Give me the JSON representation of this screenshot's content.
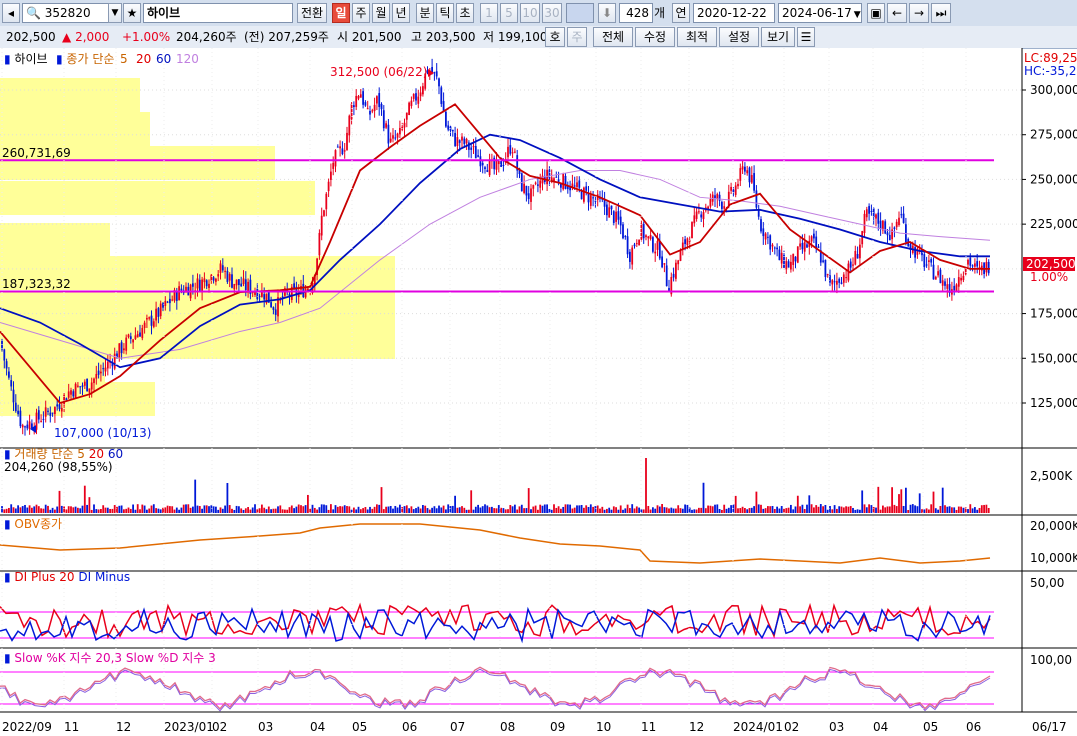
{
  "toolbar": {
    "code": "352820",
    "name": "하이브",
    "convert_label": "전환",
    "periods": [
      "일",
      "주",
      "월",
      "년"
    ],
    "minute_units": [
      "분",
      "틱",
      "초"
    ],
    "intervals": [
      "1",
      "5",
      "10",
      "30"
    ],
    "count": "428",
    "count_unit": "개",
    "date_mode": "연",
    "start_date": "2020-12-22",
    "end_date": "2024-06-17"
  },
  "infobar": {
    "price": "202,500",
    "change": "2,000",
    "change_pct": "+1.00%",
    "volume": "204,260주",
    "prev_volume": "(전) 207,259주",
    "open": "시 201,500",
    "high": "고 203,500",
    "low": "저 199,100",
    "quote_btn": "호",
    "week_btn": "주",
    "menus": [
      "전체",
      "수정",
      "최적",
      "설정",
      "보기"
    ]
  },
  "colors": {
    "up": "#e8001c",
    "down": "#0018d8",
    "ma5": "#e81010",
    "ma20": "#c80000",
    "ma60": "#0010c0",
    "ma120": "#c080e0",
    "profile": "#ffff99",
    "line": "#e000e0",
    "obv": "#e06a00",
    "accent": "#ff00ff"
  },
  "panels": {
    "price": {
      "legend_name": "하이브",
      "legend_text": "종가 단순",
      "ma_labels": [
        "5",
        "20",
        "60",
        "120"
      ],
      "lc": "LC:89,25",
      "hc": "HC:-35,20",
      "hline_upper": "260,731,69",
      "hline_lower": "187,323,32",
      "high_note": "312,500 (06/22)",
      "low_note": "107,000 (10/13)",
      "last_price": "202,500",
      "last_pct": "1.00%"
    },
    "volume": {
      "legend_name": "거래량",
      "legend_text": "단순",
      "ma_labels": [
        "5",
        "20",
        "60"
      ],
      "value": "204,260 (98,55%)",
      "axis": "2,500K"
    },
    "obv": {
      "legend": "OBV종가",
      "axis": [
        "20,000K",
        "10,000K"
      ]
    },
    "dmi": {
      "legend_plus": "DI Plus 20",
      "legend_minus": "DI Minus",
      "axis": "50,00"
    },
    "stoch": {
      "legend_k": "Slow %K 지수 20,3",
      "legend_d": "Slow %D 지수 3",
      "axis": "100,00"
    }
  },
  "chart_data": {
    "type": "candlestick",
    "y_axis_ticks": [
      300000,
      275000,
      250000,
      225000,
      200000,
      175000,
      150000,
      125000
    ],
    "ylim": [
      105000,
      320000
    ],
    "x_tick_labels": [
      "2022/09",
      "11",
      "12",
      "2023/01",
      "02",
      "03",
      "04",
      "05",
      "06",
      "07",
      "08",
      "09",
      "10",
      "11",
      "12",
      "2024/01",
      "02",
      "03",
      "04",
      "05",
      "06",
      "06/17"
    ],
    "close_path": [
      [
        0,
        160000
      ],
      [
        10,
        135000
      ],
      [
        22,
        112000
      ],
      [
        35,
        115000
      ],
      [
        55,
        122000
      ],
      [
        70,
        132000
      ],
      [
        90,
        136000
      ],
      [
        110,
        148000
      ],
      [
        125,
        158000
      ],
      [
        145,
        168000
      ],
      [
        160,
        176000
      ],
      [
        180,
        188000
      ],
      [
        200,
        192000
      ],
      [
        210,
        196000
      ],
      [
        222,
        200000
      ],
      [
        232,
        193000
      ],
      [
        250,
        189000
      ],
      [
        265,
        186000
      ],
      [
        275,
        178000
      ],
      [
        285,
        185000
      ],
      [
        300,
        187000
      ],
      [
        312,
        192000
      ],
      [
        318,
        210000
      ],
      [
        322,
        230000
      ],
      [
        328,
        245000
      ],
      [
        333,
        260000
      ],
      [
        345,
        270000
      ],
      [
        352,
        292000
      ],
      [
        360,
        300000
      ],
      [
        368,
        285000
      ],
      [
        378,
        295000
      ],
      [
        390,
        270000
      ],
      [
        400,
        275000
      ],
      [
        410,
        290000
      ],
      [
        420,
        300000
      ],
      [
        428,
        312500
      ],
      [
        438,
        305000
      ],
      [
        446,
        280000
      ],
      [
        455,
        272000
      ],
      [
        465,
        270000
      ],
      [
        480,
        262000
      ],
      [
        495,
        255000
      ],
      [
        505,
        262000
      ],
      [
        512,
        270000
      ],
      [
        520,
        248000
      ],
      [
        530,
        240000
      ],
      [
        545,
        252000
      ],
      [
        560,
        250000
      ],
      [
        575,
        245000
      ],
      [
        590,
        240000
      ],
      [
        605,
        235000
      ],
      [
        620,
        225000
      ],
      [
        630,
        208000
      ],
      [
        640,
        222000
      ],
      [
        650,
        215000
      ],
      [
        660,
        210000
      ],
      [
        668,
        190000
      ],
      [
        675,
        200000
      ],
      [
        685,
        215000
      ],
      [
        700,
        232000
      ],
      [
        715,
        240000
      ],
      [
        725,
        236000
      ],
      [
        735,
        245000
      ],
      [
        745,
        258000
      ],
      [
        752,
        248000
      ],
      [
        760,
        225000
      ],
      [
        770,
        215000
      ],
      [
        780,
        205000
      ],
      [
        790,
        202000
      ],
      [
        800,
        210000
      ],
      [
        812,
        215000
      ],
      [
        820,
        208000
      ],
      [
        830,
        190000
      ],
      [
        840,
        195000
      ],
      [
        850,
        200000
      ],
      [
        858,
        210000
      ],
      [
        866,
        230000
      ],
      [
        874,
        228000
      ],
      [
        882,
        225000
      ],
      [
        892,
        218000
      ],
      [
        900,
        232000
      ],
      [
        908,
        215000
      ],
      [
        918,
        208000
      ],
      [
        930,
        200000
      ],
      [
        940,
        195000
      ],
      [
        950,
        188000
      ],
      [
        958,
        195000
      ],
      [
        968,
        205000
      ],
      [
        978,
        198000
      ],
      [
        990,
        202500
      ]
    ],
    "ma20_path": [
      [
        0,
        165000
      ],
      [
        30,
        145000
      ],
      [
        60,
        125000
      ],
      [
        90,
        130000
      ],
      [
        120,
        140000
      ],
      [
        160,
        160000
      ],
      [
        200,
        178000
      ],
      [
        240,
        187000
      ],
      [
        280,
        188000
      ],
      [
        310,
        190000
      ],
      [
        330,
        215000
      ],
      [
        360,
        255000
      ],
      [
        390,
        268000
      ],
      [
        420,
        280000
      ],
      [
        455,
        292000
      ],
      [
        470,
        282000
      ],
      [
        500,
        262000
      ],
      [
        530,
        252000
      ],
      [
        560,
        248000
      ],
      [
        600,
        240000
      ],
      [
        640,
        230000
      ],
      [
        670,
        208000
      ],
      [
        700,
        215000
      ],
      [
        730,
        236000
      ],
      [
        760,
        242000
      ],
      [
        790,
        222000
      ],
      [
        820,
        210000
      ],
      [
        850,
        198000
      ],
      [
        880,
        210000
      ],
      [
        910,
        215000
      ],
      [
        940,
        205000
      ],
      [
        970,
        200000
      ],
      [
        990,
        200000
      ]
    ],
    "ma60_path": [
      [
        0,
        178000
      ],
      [
        40,
        170000
      ],
      [
        80,
        158000
      ],
      [
        120,
        145000
      ],
      [
        160,
        150000
      ],
      [
        200,
        168000
      ],
      [
        240,
        180000
      ],
      [
        280,
        183000
      ],
      [
        310,
        188000
      ],
      [
        340,
        205000
      ],
      [
        380,
        225000
      ],
      [
        420,
        248000
      ],
      [
        460,
        267000
      ],
      [
        490,
        275000
      ],
      [
        520,
        272000
      ],
      [
        560,
        262000
      ],
      [
        600,
        250000
      ],
      [
        640,
        240000
      ],
      [
        680,
        236000
      ],
      [
        720,
        232000
      ],
      [
        760,
        233000
      ],
      [
        800,
        228000
      ],
      [
        840,
        222000
      ],
      [
        880,
        215000
      ],
      [
        920,
        210000
      ],
      [
        960,
        207000
      ],
      [
        990,
        207000
      ]
    ],
    "ma120_path": [
      [
        0,
        170000
      ],
      [
        60,
        160000
      ],
      [
        120,
        150000
      ],
      [
        180,
        155000
      ],
      [
        240,
        165000
      ],
      [
        280,
        170000
      ],
      [
        320,
        178000
      ],
      [
        380,
        205000
      ],
      [
        430,
        225000
      ],
      [
        480,
        240000
      ],
      [
        530,
        250000
      ],
      [
        580,
        255000
      ],
      [
        620,
        255000
      ],
      [
        660,
        250000
      ],
      [
        700,
        240000
      ],
      [
        740,
        238000
      ],
      [
        780,
        235000
      ],
      [
        820,
        230000
      ],
      [
        860,
        225000
      ],
      [
        900,
        220000
      ],
      [
        940,
        218000
      ],
      [
        990,
        216000
      ]
    ],
    "horizontal_levels": [
      260731.69,
      187323.32
    ],
    "annotations": [
      {
        "label": "312,500 (06/22)",
        "value": 312500
      },
      {
        "label": "107,000 (10/13)",
        "value": 107000
      }
    ]
  }
}
